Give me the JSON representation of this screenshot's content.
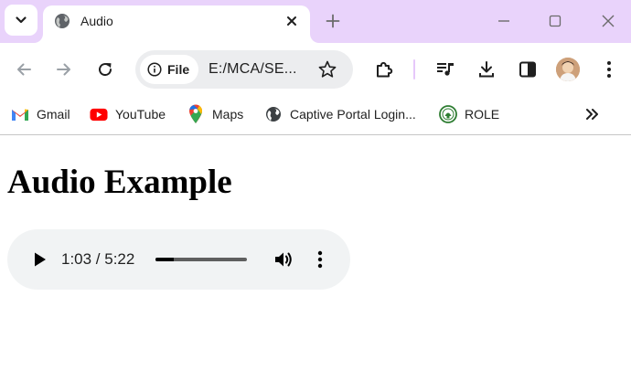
{
  "tab": {
    "title": "Audio"
  },
  "toolbar": {
    "site_chip": "File",
    "url": "E:/MCA/SE..."
  },
  "bookmarks": [
    {
      "label": "Gmail",
      "icon": "gmail-icon"
    },
    {
      "label": "YouTube",
      "icon": "youtube-icon"
    },
    {
      "label": "Maps",
      "icon": "maps-icon"
    },
    {
      "label": "Captive Portal Login...",
      "icon": "globe-icon"
    },
    {
      "label": "ROLE",
      "icon": "role-icon"
    }
  ],
  "page": {
    "heading": "Audio Example",
    "audio": {
      "time": "1:03 / 5:22",
      "progress": 0.196
    }
  },
  "colors": {
    "tabstrip": "#e9d3fb",
    "omnibox": "#ecedef",
    "player": "#f1f3f4"
  }
}
